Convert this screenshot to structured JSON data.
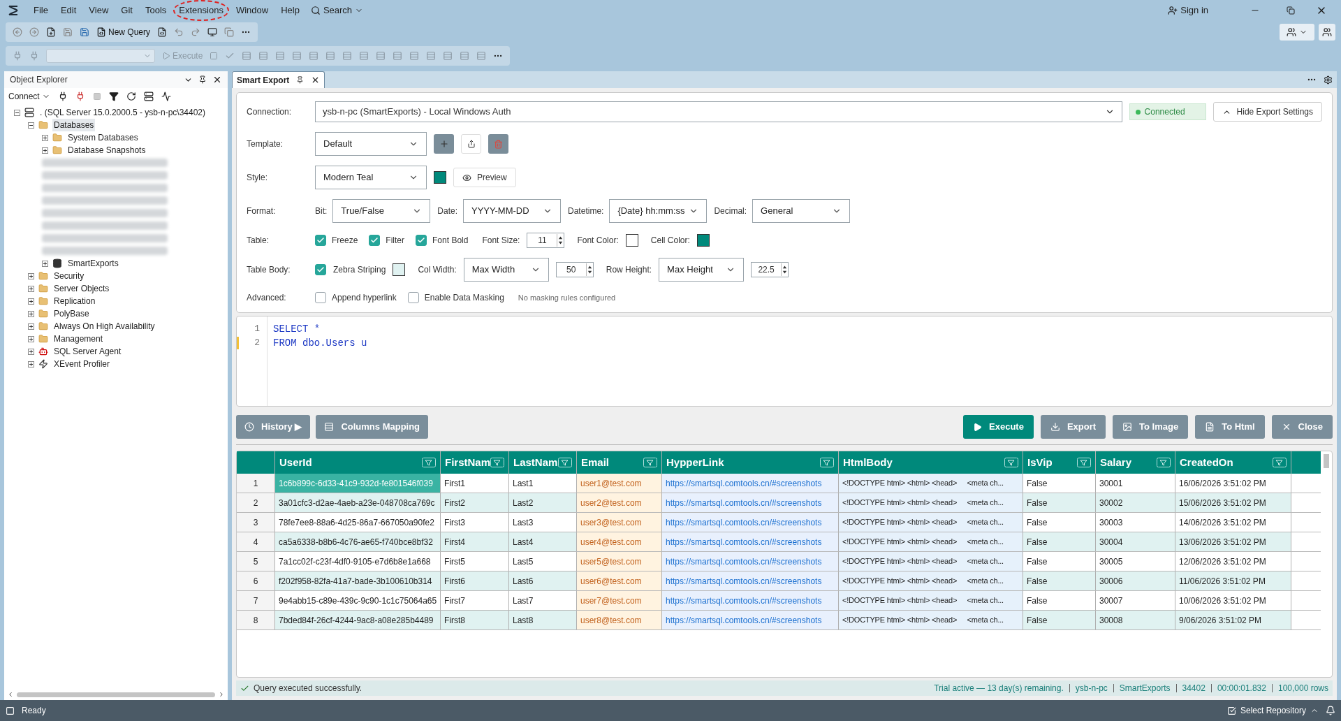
{
  "menu": [
    {
      "label": "File",
      "circled": false
    },
    {
      "label": "Edit",
      "circled": false
    },
    {
      "label": "View",
      "circled": false
    },
    {
      "label": "Git",
      "circled": false
    },
    {
      "label": "Tools",
      "circled": false
    },
    {
      "label": "Extensions",
      "circled": true
    },
    {
      "label": "Window",
      "circled": false
    },
    {
      "label": "Help",
      "circled": false
    }
  ],
  "search": "Search",
  "sign_in": "Sign in",
  "toolbar": {
    "new_query": "New Query",
    "execute": "Execute"
  },
  "object_explorer": {
    "title": "Object Explorer",
    "connect": "Connect",
    "tree": [
      {
        "kind": "server",
        "label": ". (SQL Server 15.0.2000.5 - ysb-n-pc\\34402)",
        "expanded": true,
        "children": [
          {
            "kind": "folder",
            "label": "Databases",
            "expanded": true,
            "selected": true,
            "children": [
              {
                "kind": "folder",
                "label": "System Databases",
                "expanded": false
              },
              {
                "kind": "folder",
                "label": "Database Snapshots",
                "expanded": false
              },
              {
                "kind": "blurred"
              },
              {
                "kind": "blurred"
              },
              {
                "kind": "blurred"
              },
              {
                "kind": "blurred"
              },
              {
                "kind": "blurred"
              },
              {
                "kind": "blurred"
              },
              {
                "kind": "blurred"
              },
              {
                "kind": "blurred"
              },
              {
                "kind": "database",
                "label": "SmartExports",
                "expanded": false
              }
            ]
          },
          {
            "kind": "folder",
            "label": "Security",
            "expanded": false
          },
          {
            "kind": "folder",
            "label": "Server Objects",
            "expanded": false
          },
          {
            "kind": "folder",
            "label": "Replication",
            "expanded": false
          },
          {
            "kind": "folder",
            "label": "PolyBase",
            "expanded": false
          },
          {
            "kind": "folder",
            "label": "Always On High Availability",
            "expanded": false
          },
          {
            "kind": "folder",
            "label": "Management",
            "expanded": false
          },
          {
            "kind": "agent",
            "label": "SQL Server Agent",
            "expanded": false
          },
          {
            "kind": "profiler",
            "label": "XEvent Profiler",
            "expanded": false
          }
        ]
      }
    ]
  },
  "tab": {
    "title": "Smart Export"
  },
  "settings": {
    "connection": {
      "label": "Connection:",
      "value": "ysb-n-pc (SmartExports) - Local Windows Auth"
    },
    "status": "Connected",
    "hide_button": "Hide Export Settings",
    "template": {
      "label": "Template:",
      "value": "Default"
    },
    "style": {
      "label": "Style:",
      "value": "Modern Teal",
      "color": "#00897b",
      "preview": "Preview"
    },
    "format": {
      "label": "Format:",
      "fields": [
        {
          "label": "Bit:",
          "value": "True/False"
        },
        {
          "label": "Date:",
          "value": "YYYY-MM-DD"
        },
        {
          "label": "Datetime:",
          "value": "{Date} hh:mm:ss"
        },
        {
          "label": "Decimal:",
          "value": "General"
        }
      ]
    },
    "table": {
      "label": "Table:",
      "checks": [
        {
          "label": "Freeze",
          "checked": true
        },
        {
          "label": "Filter",
          "checked": true
        },
        {
          "label": "Font Bold",
          "checked": true
        }
      ],
      "font_size": {
        "label": "Font Size:",
        "value": "11"
      },
      "font_color": {
        "label": "Font Color:",
        "color": "#ffffff"
      },
      "cell_color": {
        "label": "Cell Color:",
        "color": "#00897b"
      }
    },
    "table_body": {
      "label": "Table Body:",
      "zebra": {
        "label": "Zebra Striping",
        "checked": true,
        "color": "#e0f2f1"
      },
      "col_width": {
        "label": "Col Width:",
        "value": "Max Width",
        "number": "50"
      },
      "row_height": {
        "label": "Row Height:",
        "value": "Max Height",
        "number": "22.5"
      }
    },
    "advanced": {
      "label": "Advanced:",
      "checks": [
        {
          "label": "Append hyperlink",
          "checked": false
        },
        {
          "label": "Enable Data Masking",
          "checked": false
        }
      ],
      "note": "No masking rules configured"
    }
  },
  "editor": {
    "lines": [
      {
        "number": "1",
        "text": "SELECT *",
        "modified": false
      },
      {
        "number": "2",
        "text": "FROM dbo.Users u",
        "modified": true
      }
    ]
  },
  "buttons_left": [
    {
      "kind": "history",
      "label": "History ▶"
    },
    {
      "kind": "mapping",
      "label": "Columns Mapping"
    }
  ],
  "buttons_right": [
    {
      "kind": "execute",
      "label": "Execute",
      "primary": true
    },
    {
      "kind": "export",
      "label": "Export",
      "primary": false
    },
    {
      "kind": "image",
      "label": "To Image",
      "primary": false
    },
    {
      "kind": "html",
      "label": "To Html",
      "primary": false
    },
    {
      "kind": "close",
      "label": "Close",
      "primary": false
    }
  ],
  "grid": {
    "columns": [
      {
        "name": "UserId",
        "kind": "text"
      },
      {
        "name": "FirstNam",
        "kind": "text"
      },
      {
        "name": "LastNam",
        "kind": "text"
      },
      {
        "name": "Email",
        "kind": "email"
      },
      {
        "name": "HypperLink",
        "kind": "link"
      },
      {
        "name": "HtmlBody",
        "kind": "html"
      },
      {
        "name": "IsVip",
        "kind": "text"
      },
      {
        "name": "Salary",
        "kind": "text"
      },
      {
        "name": "CreatedOn",
        "kind": "text"
      }
    ],
    "rows": [
      {
        "number": "1",
        "selected": true,
        "cells": [
          "1c6b899c-6d33-41c9-932d-fe801546f039",
          "First1",
          "Last1",
          "user1@test.com",
          "https://smartsql.comtools.cn/#screenshots",
          "<!DOCTYPE html> <html> <head>     <meta ch...",
          "False",
          "30001",
          "16/06/2026 3:51:02 PM"
        ]
      },
      {
        "number": "2",
        "selected": false,
        "cells": [
          "3a01cfc3-d2ae-4aeb-a23e-048708ca769c",
          "First2",
          "Last2",
          "user2@test.com",
          "https://smartsql.comtools.cn/#screenshots",
          "<!DOCTYPE html> <html> <head>     <meta ch...",
          "False",
          "30002",
          "15/06/2026 3:51:02 PM"
        ]
      },
      {
        "number": "3",
        "selected": false,
        "cells": [
          "78fe7ee8-88a6-4d25-86a7-667050a90fe2",
          "First3",
          "Last3",
          "user3@test.com",
          "https://smartsql.comtools.cn/#screenshots",
          "<!DOCTYPE html> <html> <head>     <meta ch...",
          "False",
          "30003",
          "14/06/2026 3:51:02 PM"
        ]
      },
      {
        "number": "4",
        "selected": false,
        "cells": [
          "ca5a6338-b8b6-4c76-ae65-f740bce8bf32",
          "First4",
          "Last4",
          "user4@test.com",
          "https://smartsql.comtools.cn/#screenshots",
          "<!DOCTYPE html> <html> <head>     <meta ch...",
          "False",
          "30004",
          "13/06/2026 3:51:02 PM"
        ]
      },
      {
        "number": "5",
        "selected": false,
        "cells": [
          "7a1cc02f-c23f-4df0-9105-e7d6b8e1a668",
          "First5",
          "Last5",
          "user5@test.com",
          "https://smartsql.comtools.cn/#screenshots",
          "<!DOCTYPE html> <html> <head>     <meta ch...",
          "False",
          "30005",
          "12/06/2026 3:51:02 PM"
        ]
      },
      {
        "number": "6",
        "selected": false,
        "cells": [
          "f202f958-82fa-41a7-bade-3b100610b314",
          "First6",
          "Last6",
          "user6@test.com",
          "https://smartsql.comtools.cn/#screenshots",
          "<!DOCTYPE html> <html> <head>     <meta ch...",
          "False",
          "30006",
          "11/06/2026 3:51:02 PM"
        ]
      },
      {
        "number": "7",
        "selected": false,
        "cells": [
          "9e4abb15-c89e-439c-9c90-1c1c75064a65",
          "First7",
          "Last7",
          "user7@test.com",
          "https://smartsql.comtools.cn/#screenshots",
          "<!DOCTYPE html> <html> <head>     <meta ch...",
          "False",
          "30007",
          "10/06/2026 3:51:02 PM"
        ]
      },
      {
        "number": "8",
        "selected": false,
        "cells": [
          "7bded84f-26cf-4244-9ac8-a08e285b4489",
          "First8",
          "Last8",
          "user8@test.com",
          "https://smartsql.comtools.cn/#screenshots",
          "<!DOCTYPE html> <html> <head>     <meta ch...",
          "False",
          "30008",
          "9/06/2026 3:51:02 PM"
        ]
      }
    ]
  },
  "result_status": {
    "message": "Query executed successfully.",
    "parts": [
      "Trial active — 13 day(s) remaining.",
      "ysb-n-pc",
      "SmartExports",
      "34402",
      "00:00:01.832",
      "100,000 rows"
    ]
  },
  "status_bar": {
    "ready": "Ready",
    "repository": "Select Repository"
  }
}
